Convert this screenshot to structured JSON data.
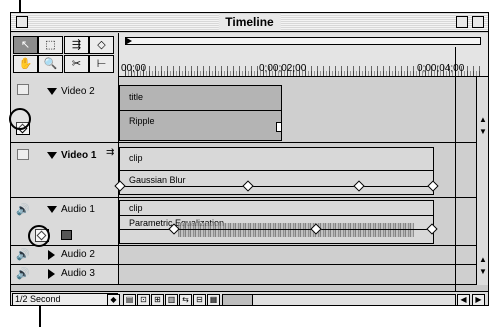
{
  "window": {
    "title": "Timeline"
  },
  "ruler": {
    "times": [
      "00;00",
      "0;00;02;00",
      "0;00;04;00"
    ]
  },
  "tracks": [
    {
      "name": "Video 2",
      "clip": "title",
      "effect": "Ripple"
    },
    {
      "name": "Video 1",
      "clip": "clip",
      "effect": "Gaussian Blur"
    },
    {
      "name": "Audio 1",
      "clip": "clip",
      "effect": "Parametric Equalization"
    },
    {
      "name": "Audio 2"
    },
    {
      "name": "Audio 3"
    }
  ],
  "bottom": {
    "time_unit": "1/2 Second"
  },
  "icons": [
    "selection-tool-icon",
    "marquee-tool-icon",
    "track-tool-icon",
    "hand-tool-icon",
    "zoom-tool-icon",
    "razor-tool-icon",
    "in-out-tool-icon",
    "eye-icon",
    "speaker-icon",
    "keyframe-icon",
    "expand-triangle-icon",
    "collapse-triangle-icon",
    "scroll-arrow-icon"
  ]
}
